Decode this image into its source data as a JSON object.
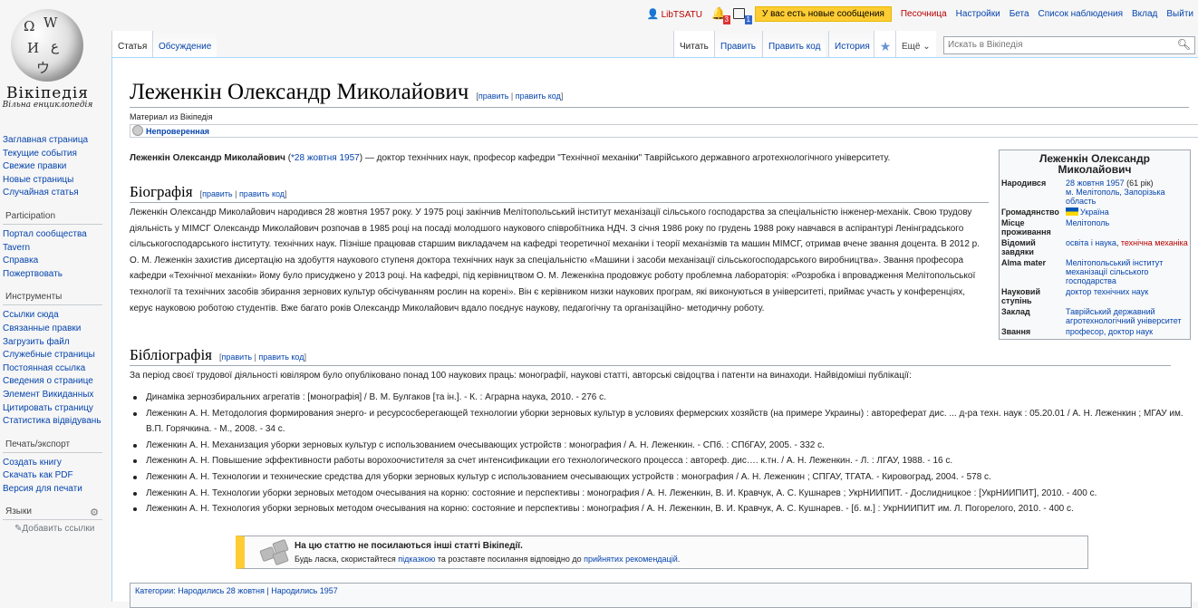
{
  "logo": {
    "wordmark": "Вікіпедія",
    "tagline": "Вільна енциклопедія"
  },
  "personal": {
    "username": "LibTSATU",
    "alerts_count": "3",
    "notices_count": "1",
    "new_messages": "У вас есть новые сообщения",
    "links": [
      "Песочница",
      "Настройки",
      "Бета",
      "Список наблюдения",
      "Вклад",
      "Выйти"
    ]
  },
  "tabs": {
    "article": "Статья",
    "talk": "Обсуждение",
    "read": "Читать",
    "edit": "Править",
    "edit_code": "Править код",
    "history": "История",
    "more": "Ещё"
  },
  "search": {
    "placeholder": "Искать в Вікіпедія"
  },
  "sidebar": {
    "navigation": [
      "Заглавная страница",
      "Текущие события",
      "Свежие правки",
      "Новые страницы",
      "Случайная статья"
    ],
    "participation_heading": "Participation",
    "participation": [
      "Портал сообщества",
      "Tavern",
      "Справка",
      "Пожертвовать"
    ],
    "tools_heading": "Инструменты",
    "tools": [
      "Ссылки сюда",
      "Связанные правки",
      "Загрузить файл",
      "Служебные страницы",
      "Постоянная ссылка",
      "Сведения о странице",
      "Элемент Викиданных",
      "Цитировать страницу",
      "Статистика відвідувань"
    ],
    "print_heading": "Печать/экспорт",
    "print": [
      "Создать книгу",
      "Скачать как PDF",
      "Версия для печати"
    ],
    "languages_heading": "Языки",
    "add_links": "Добавить ссылки"
  },
  "article": {
    "title": "Леженкін Олександр Миколайович",
    "edit": "править",
    "edit_code": "править код",
    "site_sub": "Материал из Вікіпедія",
    "flagged": "Непроверенная",
    "lead_name": "Леженкін Олександр Миколайович",
    "lead_date": "*28 жовтня 1957",
    "lead_rest": " — доктор технічних наук, професор кафедри \"Технічної механіки\" Таврійського державного агротехнологічного університету.",
    "bio_heading": "Біографія",
    "bio_text": "Леженкін Олександр Миколайович народився 28 жовтня 1957 року. У 1975 році закінчив Мелітопольський інститут механізації сільського господарства за спеціальністю інженер-механік. Свою трудову діяльність у МІМСГ Олександр Миколайович розпочав в 1985 році на посаді молодшого наукового співробітника НДЧ. З січня 1986 року по грудень 1988 року навчався в аспірантурі Ленінградського сільськогосподарського інституту. технічних наук. Пізніше працював старшим викладачем на кафедрі теоретичної механіки і теорії механізмів та машин МІМСГ, отримав вчене звання доцента. В 2012 р. О. М. Леженкін захистив дисертацію на здобуття наукового ступеня доктора технічних наук за спеціальністю «Машини і засоби механізації сільськогосподарського виробництва». Звання професора кафедри «Технічної механіки» йому було присуджено у 2013 році. На кафедрі, під керівництвом О. М. Леженкіна продовжує роботу проблемна лабораторія: «Розробка і впровадження Мелітопольської технології та технічних засобів збирання зернових культур обсічуванням рослин на корені». Він є керівником низки наукових програм, які виконуються в університеті, приймає участь у конференціях, керує науковою роботою студентів. Вже багато років Олександр Миколайович вдало поєднує наукову, педагогічну та організаційно- методичну роботу.",
    "bib_heading": "Бібліографія",
    "bib_intro": "За період своєї трудової діяльності ювіляром було опубліковано понад 100 наукових праць: монографії, наукові статті, авторські свідоцтва і патенти на винаходи. Найвідоміші публікації:",
    "publications": [
      "Динаміка зернозбиральних агрегатів : [монографія] / В. М. Булгаков [та ін.]. - К. : Аграрна наука, 2010. - 276 с.",
      "Леженкин А. Н. Методология формирования энерго- и ресурсосберегающей технологии уборки зерновых культур в условиях фермерских хозяйств (на примере Украины) : автореферат дис. ... д-ра техн. наук : 05.20.01 / А. Н. Леженкин ; МГАУ им. В.П. Горячкина. - М., 2008. - 34 с.",
      "Леженкин А. Н. Механизация уборки зерновых культур с использованием очесывающих устройств : монография / А. Н. Леженкин. - СПб. : СПбГАУ, 2005. - 332 с.",
      "Леженкин А. Н. Повышение эффективности работы ворохоочистителя за счет интенсификации его технологического процесса : автореф. дис…. к.тн. / А. Н. Леженкин. - Л. : ЛГАУ, 1988. - 16 с.",
      "Леженкин А. Н. Технологии и технические средства для уборки зерновых культур с использованием очесывающих устройств : монография / А. Н. Леженкин ; СПГАУ, ТГАТА. - Кировоград, 2004. - 578 с.",
      "Леженкин А. Н. Технологии уборки зерновых методом очесывания на корню: состояние и перспективы : монография / А. Н. Леженкин, В. И. Кравчук, А. С. Кушнарев ; УкрНИИПИТ. - Дослидницкое : [УкрНИИПИТ], 2010. - 400 с.",
      "Леженкин А. Н. Технология уборки зерновых методом очесывания на корню: состояние и перспективы : монография / А. Н. Леженкин, В. И. Кравчук, А. С. Кушнарев. - [б. м.] : УкрНИИПИТ им. Л. Погорелого, 2010. - 400 с."
    ],
    "orphan_title": "На цю статтю не посилаються інші статті Вікіпедії.",
    "orphan_pre": "Будь ласка, скористайтеся ",
    "orphan_link1": "підказкою",
    "orphan_mid": " та розставте посилання відповідно до ",
    "orphan_link2": "прийнятих рекомендацій",
    "orphan_end": ".",
    "categories_text": "Категории: Народились 28 жовтня | Народились 1957"
  },
  "infobox": {
    "title": "Леженкін Олександр Миколайович",
    "born_label": "Народився",
    "born_date": "28 жовтня 1957",
    "born_age": " (61 рік)",
    "born_place": "м. Мелітополь, Запорізька область",
    "citizenship_label": "Громадянство",
    "citizenship": "Україна",
    "residence_label": "Місце проживання",
    "residence": "Мелітополь",
    "known_label": "Відомий завдяки",
    "known_blue": "освіта і наука",
    "known_sep": ", ",
    "known_red": "технічна механіка",
    "alma_label": "Alma mater",
    "alma": "Мелітопольський інститут механізації сільського господарства",
    "degree_label": "Науковий ступінь",
    "degree": "доктор технічних наук",
    "institution_label": "Заклад",
    "institution": "Таврійський державний агротехнологічний університет",
    "rank_label": "Звання",
    "rank": "професор, доктор наук"
  }
}
